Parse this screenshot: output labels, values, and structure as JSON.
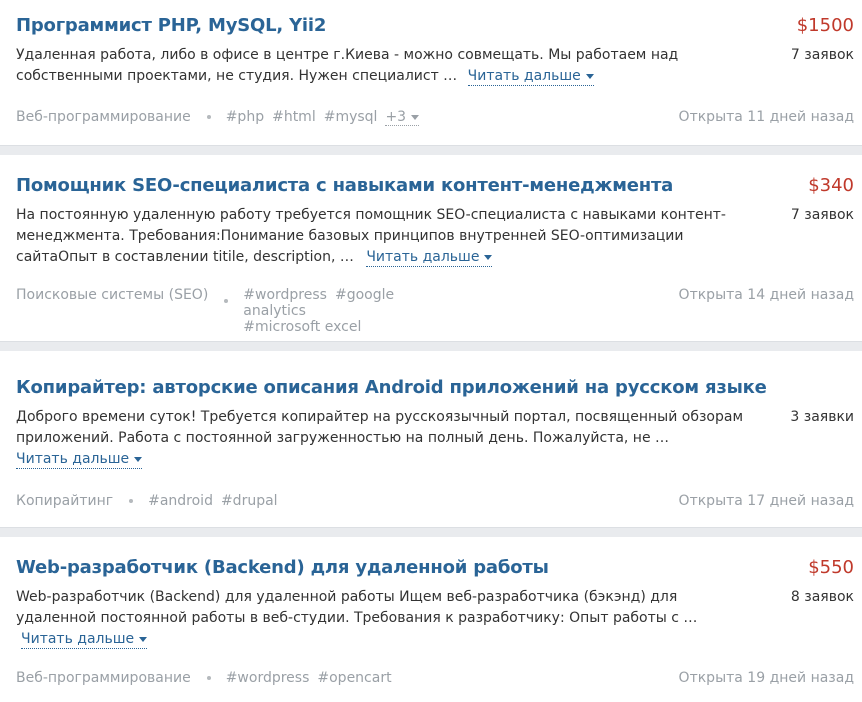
{
  "jobs": [
    {
      "title": "Программист PHP, MySQL, Yii2",
      "price": "$1500",
      "bids": "7 заявок",
      "desc_lines": [
        "Удаленная работа, либо в офисе в центре г.Киева - можно совмещать.   Мы работаем над",
        "собственными проектами, не студия.  Нужен специалист …"
      ],
      "read_more": "Читать дальше",
      "category": "Веб-программирование",
      "tags": [
        "#php",
        "#html",
        "#mysql"
      ],
      "more_tags": "+3",
      "opened": "Открыта 11 дней назад"
    },
    {
      "title": "Помощник SEO-специалиста с навыками контент-менеджмента",
      "price": "$340",
      "bids": "7 заявок",
      "desc_lines": [
        "На постоянную удаленную работу требуется помощник SEO-специалиста с навыками контент-",
        "менеджмента. Требования:Понимание базовых принципов внутренней SEO-оптимизации",
        "сайтаОпыт в составлении titile, description, …"
      ],
      "read_more": "Читать дальше",
      "category": "Поисковые системы (SEO)",
      "tags": [
        "#wordpress",
        "#google analytics",
        "#microsoft excel"
      ],
      "opened": "Открыта 14 дней назад"
    },
    {
      "title": "Копирайтер: авторские описания Android приложений на русском языке",
      "price": "",
      "bids": "3 заявки",
      "desc_lines": [
        "Доброго времени суток! Требуется копирайтер на русскоязычный портал, посвященный обзорам",
        "приложений. Работа с постоянной загруженностью на полный день. Пожалуйста, не …"
      ],
      "read_more": "Читать дальше",
      "category": "Копирайтинг",
      "tags": [
        "#android",
        "#drupal"
      ],
      "opened": "Открыта 17 дней назад"
    },
    {
      "title": "Web-разработчик (Backend) для удаленной работы",
      "price": "$550",
      "bids": "8 заявок",
      "desc_lines": [
        "Web-разработчик (Backend) для удаленной работы Ищем веб-разработчика (бэкэнд) для",
        "удаленной постоянной работы в веб-студии. Требования к разработчику: Опыт работы с …"
      ],
      "read_more": "Читать дальше",
      "category": "Веб-программирование",
      "tags": [
        "#wordpress",
        "#opencart"
      ],
      "opened": "Открыта 19 дней назад"
    }
  ],
  "colors": {
    "title": "#2a6496",
    "price": "#c0392b",
    "muted": "#9aa0a6",
    "background": "#e9ebee"
  }
}
